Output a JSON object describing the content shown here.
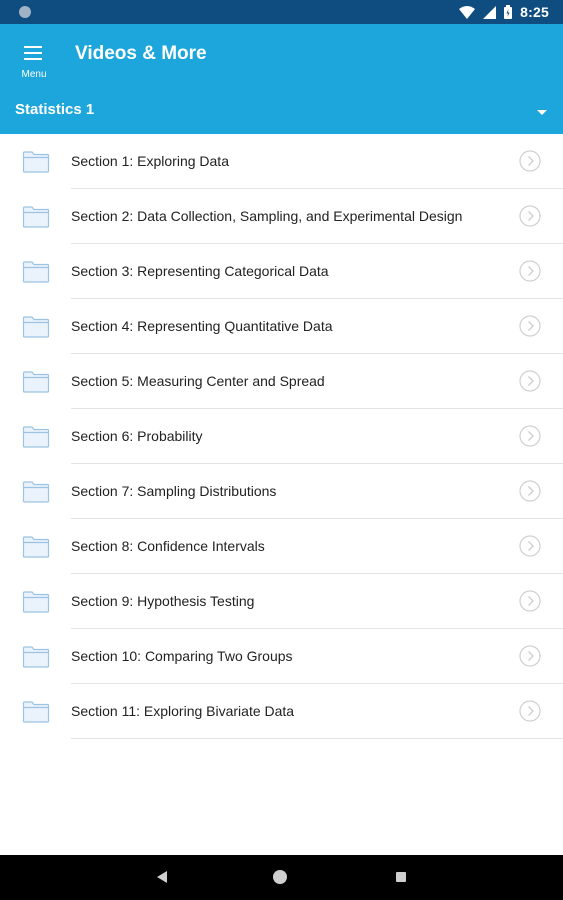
{
  "status_bar": {
    "time": "8:25",
    "icons": [
      "notification-dot-icon",
      "wifi-icon",
      "signal-icon",
      "battery-icon"
    ]
  },
  "app_bar": {
    "menu_label": "Menu",
    "title": "Videos & More",
    "course": "Statistics 1",
    "background_color": "#1da6db"
  },
  "sections": [
    {
      "label": "Section 1: Exploring Data"
    },
    {
      "label": "Section 2: Data Collection, Sampling, and Experimental Design"
    },
    {
      "label": "Section 3: Representing Categorical Data"
    },
    {
      "label": "Section 4: Representing Quantitative Data"
    },
    {
      "label": "Section 5: Measuring Center and Spread"
    },
    {
      "label": "Section 6: Probability"
    },
    {
      "label": "Section 7: Sampling Distributions"
    },
    {
      "label": "Section 8: Confidence Intervals"
    },
    {
      "label": "Section 9: Hypothesis Testing"
    },
    {
      "label": "Section 10: Comparing Two Groups"
    },
    {
      "label": "Section 11: Exploring Bivariate Data"
    }
  ],
  "nav_bar": {
    "icons": [
      "back-icon",
      "home-icon",
      "recents-icon"
    ]
  }
}
